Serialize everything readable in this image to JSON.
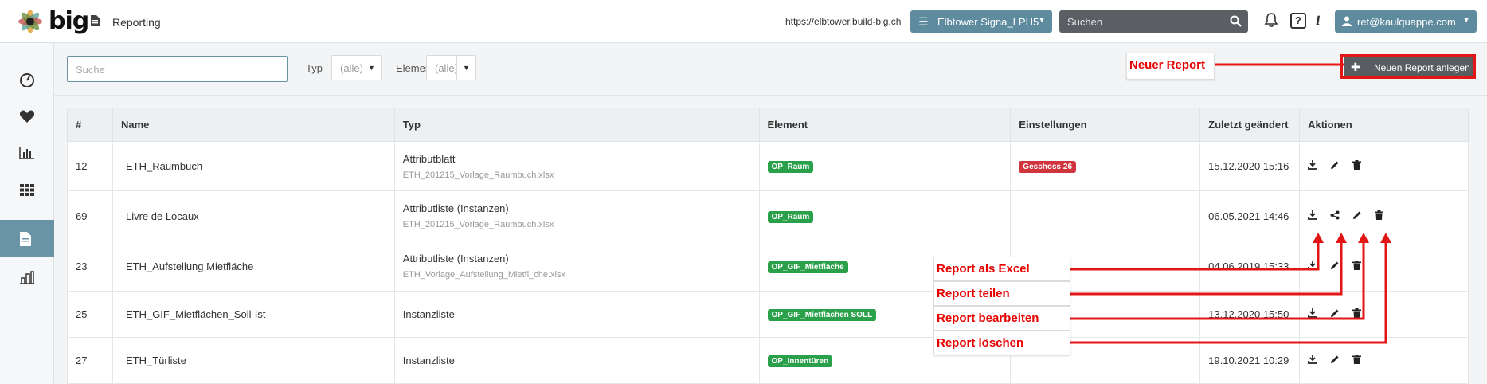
{
  "header": {
    "logo_text": "big",
    "page_title": "Reporting",
    "url": "https://elbtower.build-big.ch",
    "project_label": "Elbtower Signa_LPH5",
    "search_placeholder": "Suchen",
    "help_label": "?",
    "info_label": "i",
    "user_label": "ret@kaulquappe.com"
  },
  "sidebar": {
    "items": [
      {
        "name": "dashboard",
        "icon": "gauge-icon"
      },
      {
        "name": "favorites",
        "icon": "heart-icon"
      },
      {
        "name": "statistics",
        "icon": "bar-chart-icon"
      },
      {
        "name": "grid",
        "icon": "grid-icon"
      },
      {
        "name": "reporting",
        "icon": "document-icon",
        "active": true
      },
      {
        "name": "buildings",
        "icon": "building-chart-icon"
      }
    ]
  },
  "filters": {
    "search_placeholder": "Suche",
    "type_label": "Typ",
    "type_value": "(alle)",
    "element_label": "Element",
    "element_value": "(alle)"
  },
  "actions": {
    "new_report_label": "Neuen Report anlegen"
  },
  "table": {
    "headers": [
      "#",
      "Name",
      "Typ",
      "Element",
      "Einstellungen",
      "Zuletzt geändert",
      "Aktionen"
    ],
    "rows": [
      {
        "id": "12",
        "name": "ETH_Raumbuch",
        "type": "Attributblatt",
        "file": "ETH_201215_Vorlage_Raumbuch.xlsx",
        "element": "OP_Raum",
        "setting": "Geschoss 26",
        "modified": "15.12.2020 15:16",
        "share": false
      },
      {
        "id": "69",
        "name": "Livre de Locaux",
        "type": "Attributliste (Instanzen)",
        "file": "ETH_201215_Vorlage_Raumbuch.xlsx",
        "element": "OP_Raum",
        "setting": "",
        "modified": "06.05.2021 14:46",
        "share": true
      },
      {
        "id": "23",
        "name": "ETH_Aufstellung Mietfläche",
        "type": "Attributliste (Instanzen)",
        "file": "ETH_Vorlage_Aufstellung_Mietfl_che.xlsx",
        "element": "OP_GIF_Mietfläche",
        "setting": "",
        "modified": "04.06.2019 15:33",
        "share": false
      },
      {
        "id": "25",
        "name": "ETH_GIF_Mietflächen_Soll-Ist",
        "type": "Instanzliste",
        "file": "",
        "element": "OP_GIF_Mietflächen SOLL",
        "setting": "",
        "modified": "13.12.2020 15:50",
        "share": false
      },
      {
        "id": "27",
        "name": "ETH_Türliste",
        "type": "Instanzliste",
        "file": "",
        "element": "OP_Innentüren",
        "setting": "",
        "modified": "19.10.2021 10:29",
        "share": false
      }
    ]
  },
  "annotations": {
    "new_report": "Neuer Report",
    "excel": "Report als Excel",
    "share": "Report teilen",
    "edit": "Report bearbeiten",
    "delete": "Report löschen",
    "color": "#e31515"
  }
}
